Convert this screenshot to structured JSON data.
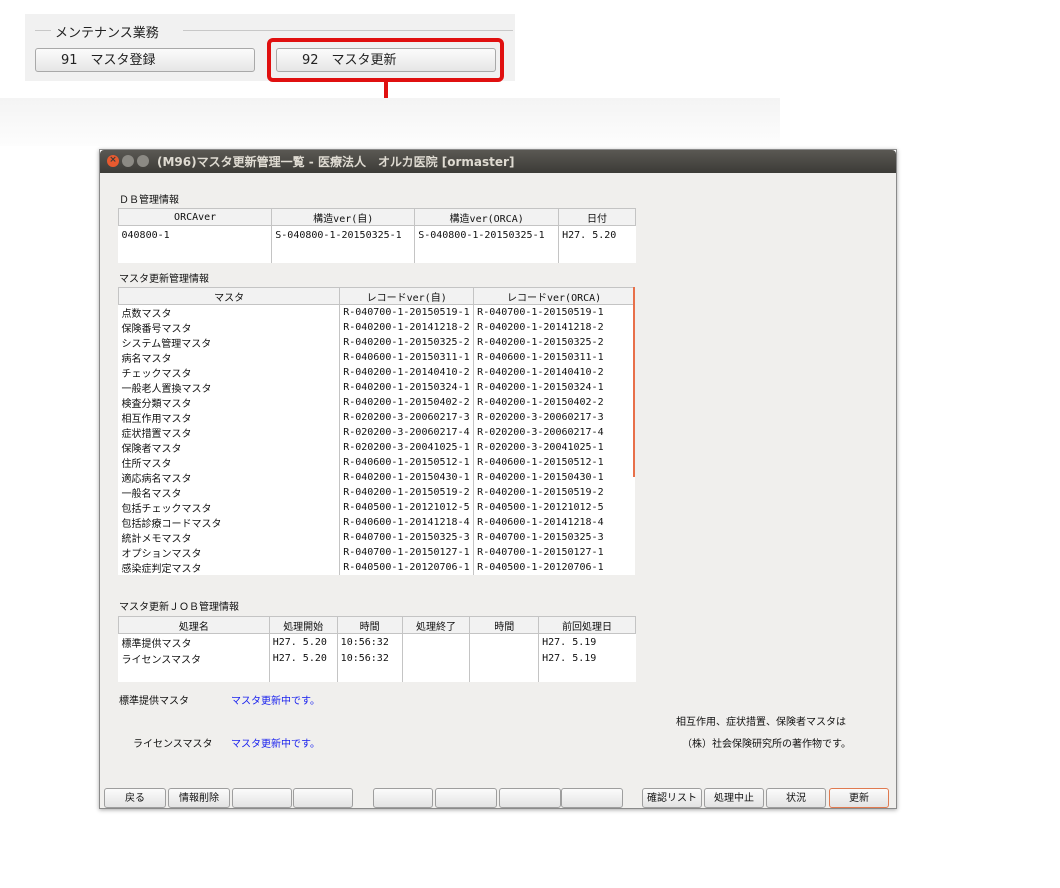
{
  "menu": {
    "group_title": "メンテナンス業務",
    "button_91": "91　マスタ登録",
    "button_92": "92　マスタ更新"
  },
  "window": {
    "title": "(M96)マスタ更新管理一覧 - 医療法人　オルカ医院 [ormaster]"
  },
  "db_info": {
    "label": "ＤＢ管理情報",
    "headers": [
      "ORCAver",
      "構造ver(自)",
      "構造ver(ORCA)",
      "日付"
    ],
    "rows": [
      [
        "040800-1",
        "S-040800-1-20150325-1",
        "S-040800-1-20150325-1",
        "H27. 5.20"
      ]
    ]
  },
  "master_info": {
    "label": "マスタ更新管理情報",
    "headers": [
      "マスタ",
      "レコードver(自)",
      "レコードver(ORCA)"
    ],
    "rows": [
      [
        "点数マスタ",
        "R-040700-1-20150519-1",
        "R-040700-1-20150519-1"
      ],
      [
        "保険番号マスタ",
        "R-040200-1-20141218-2",
        "R-040200-1-20141218-2"
      ],
      [
        "システム管理マスタ",
        "R-040200-1-20150325-2",
        "R-040200-1-20150325-2"
      ],
      [
        "病名マスタ",
        "R-040600-1-20150311-1",
        "R-040600-1-20150311-1"
      ],
      [
        "チェックマスタ",
        "R-040200-1-20140410-2",
        "R-040200-1-20140410-2"
      ],
      [
        "一般老人置換マスタ",
        "R-040200-1-20150324-1",
        "R-040200-1-20150324-1"
      ],
      [
        "検査分類マスタ",
        "R-040200-1-20150402-2",
        "R-040200-1-20150402-2"
      ],
      [
        "相互作用マスタ",
        "R-020200-3-20060217-3",
        "R-020200-3-20060217-3"
      ],
      [
        "症状措置マスタ",
        "R-020200-3-20060217-4",
        "R-020200-3-20060217-4"
      ],
      [
        "保険者マスタ",
        "R-020200-3-20041025-1",
        "R-020200-3-20041025-1"
      ],
      [
        "住所マスタ",
        "R-040600-1-20150512-1",
        "R-040600-1-20150512-1"
      ],
      [
        "適応病名マスタ",
        "R-040200-1-20150430-1",
        "R-040200-1-20150430-1"
      ],
      [
        "一般名マスタ",
        "R-040200-1-20150519-2",
        "R-040200-1-20150519-2"
      ],
      [
        "包括チェックマスタ",
        "R-040500-1-20121012-5",
        "R-040500-1-20121012-5"
      ],
      [
        "包括診療コードマスタ",
        "R-040600-1-20141218-4",
        "R-040600-1-20141218-4"
      ],
      [
        "統計メモマスタ",
        "R-040700-1-20150325-3",
        "R-040700-1-20150325-3"
      ],
      [
        "オプションマスタ",
        "R-040700-1-20150127-1",
        "R-040700-1-20150127-1"
      ],
      [
        "感染症判定マスタ",
        "R-040500-1-20120706-1",
        "R-040500-1-20120706-1"
      ]
    ]
  },
  "job_info": {
    "label": "マスタ更新ＪＯＢ管理情報",
    "headers": [
      "処理名",
      "処理開始",
      "時間",
      "処理終了",
      "時間",
      "前回処理日"
    ],
    "rows": [
      [
        "標準提供マスタ",
        "H27. 5.20",
        "10:56:32",
        "",
        "",
        "H27. 5.19"
      ],
      [
        "ライセンスマスタ",
        "H27. 5.20",
        "10:56:32",
        "",
        "",
        "H27. 5.19"
      ]
    ]
  },
  "status": {
    "standard_label": "標準提供マスタ",
    "standard_value": "マスタ更新中です。",
    "license_label": "ライセンスマスタ",
    "license_value": "マスタ更新中です。"
  },
  "notes": {
    "line1": "相互作用、症状措置、保険者マスタは",
    "line2": "（株）社会保険研究所の著作物です。"
  },
  "footer": {
    "back": "戻る",
    "delete_info": "情報削除",
    "confirm_list": "確認リスト",
    "abort": "処理中止",
    "status": "状況",
    "update": "更新"
  },
  "colors": {
    "highlight": "#e01010",
    "status_text": "#1a22ee",
    "titlebar": "#3c3b37"
  }
}
